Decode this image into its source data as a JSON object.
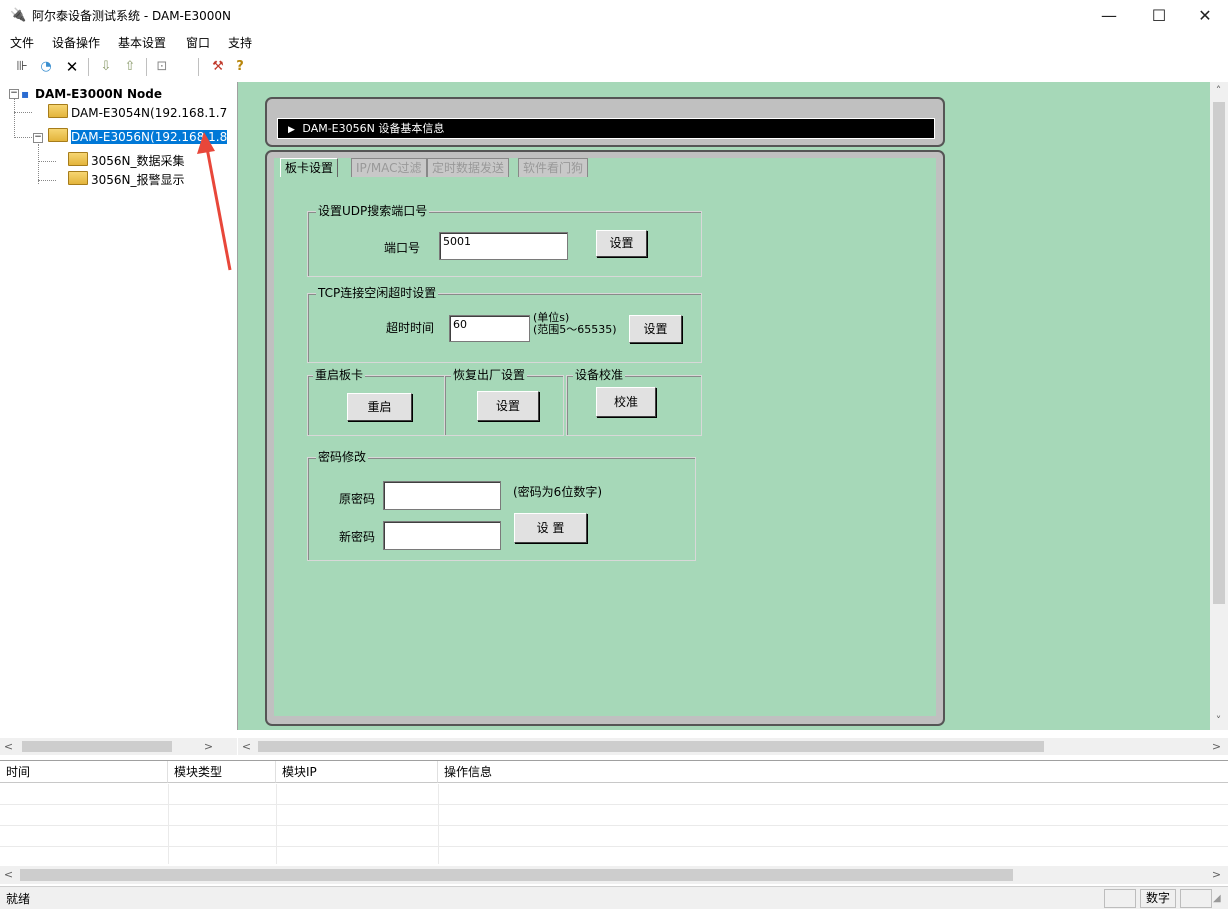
{
  "window": {
    "title": "阿尔泰设备测试系统 - DAM-E3000N",
    "minimize": "—",
    "maximize": "☐",
    "close": "✕"
  },
  "menu": [
    "文件",
    "设备操作",
    "基本设置",
    "窗口",
    "支持"
  ],
  "toolbar": {
    "icons": [
      "connect-icon",
      "search-device-icon",
      "delete-icon",
      "import-icon",
      "export-icon",
      "refresh-icon",
      "tool-icon",
      "help-icon"
    ]
  },
  "tree": {
    "root": "DAM-E3000N Node",
    "nodes": [
      {
        "label": "DAM-E3054N(192.168.1.7"
      },
      {
        "label": "DAM-E3056N(192.168.1.8"
      }
    ],
    "children": [
      "3056N_数据采集",
      "3056N_报警显示"
    ]
  },
  "panel": {
    "header": "DAM-E3056N 设备基本信息",
    "tabs": [
      "板卡设置",
      "IP/MAC过滤",
      "定时数据发送",
      "软件看门狗"
    ]
  },
  "udp_group": {
    "title": "设置UDP搜索端口号",
    "port_label": "端口号",
    "port_value": "5001",
    "set_button": "设置"
  },
  "tcp_group": {
    "title": "TCP连接空闲超时设置",
    "timeout_label": "超时时间",
    "timeout_value": "60",
    "unit": "(单位s)",
    "range": "(范围5～65535)",
    "set_button": "设置"
  },
  "restart_group": {
    "title": "重启板卡",
    "button": "重启"
  },
  "factory_group": {
    "title": "恢复出厂设置",
    "button": "设置"
  },
  "calibrate_group": {
    "title": "设备校准",
    "button": "校准"
  },
  "password_group": {
    "title": "密码修改",
    "old_label": "原密码",
    "old_value": "",
    "hint": "(密码为6位数字)",
    "new_label": "新密码",
    "new_value": "",
    "set_button": "设 置"
  },
  "log": {
    "columns": [
      "时间",
      "模块类型",
      "模块IP",
      "操作信息"
    ]
  },
  "status": {
    "left": "就绪",
    "numlock": "数字"
  },
  "colors": {
    "main_bg": "#a6d8b8",
    "selection": "#0078d7",
    "header_bar": "#000000",
    "annotation_arrow": "#e8473a"
  }
}
